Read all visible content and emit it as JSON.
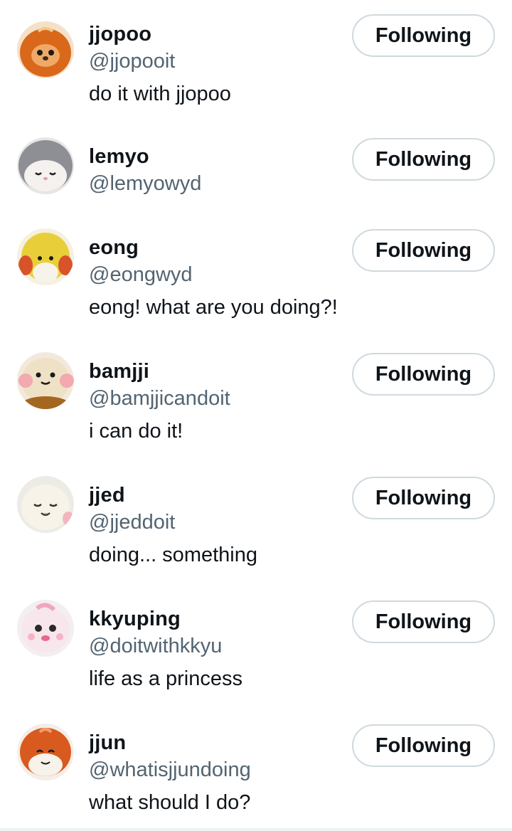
{
  "accounts": [
    {
      "name": "jjopoo",
      "handle": "@jjopooit",
      "bio": "do it with jjopoo",
      "button": "Following",
      "avatar_icon": "orange-plush-avatar-icon"
    },
    {
      "name": "lemyo",
      "handle": "@lemyowyd",
      "bio": "",
      "button": "Following",
      "avatar_icon": "gray-cat-plush-avatar-icon"
    },
    {
      "name": "eong",
      "handle": "@eongwyd",
      "bio": "eong! what are you doing?!",
      "button": "Following",
      "avatar_icon": "yellow-lion-plush-avatar-icon"
    },
    {
      "name": "bamjji",
      "handle": "@bamjjicandoit",
      "bio": "i can do it!",
      "button": "Following",
      "avatar_icon": "cream-bear-plush-avatar-icon"
    },
    {
      "name": "jjed",
      "handle": "@jjeddoit",
      "bio": "doing... something",
      "button": "Following",
      "avatar_icon": "white-plush-avatar-icon"
    },
    {
      "name": "kkyuping",
      "handle": "@doitwithkkyu",
      "bio": "life as a princess",
      "button": "Following",
      "avatar_icon": "pink-plush-avatar-icon"
    },
    {
      "name": "jjun",
      "handle": "@whatisjjundoing",
      "bio": "what should I do?",
      "button": "Following",
      "avatar_icon": "orange-fox-plush-avatar-icon"
    }
  ],
  "colors": {
    "text": "#0f1419",
    "secondary": "#536471",
    "button_border": "#cfd9de"
  }
}
